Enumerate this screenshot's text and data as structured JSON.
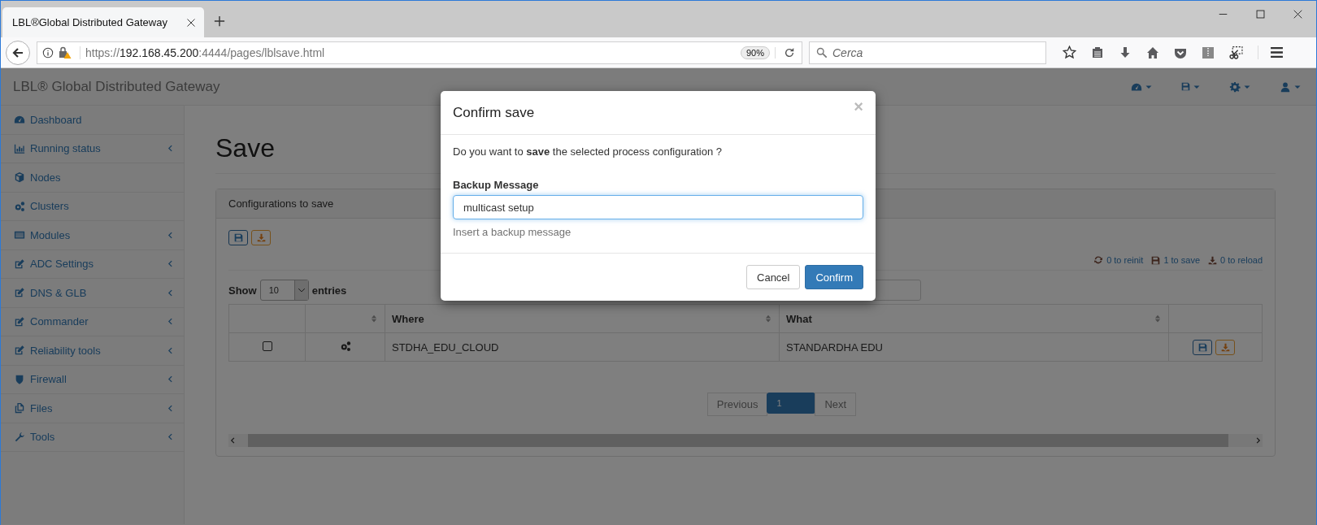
{
  "browser": {
    "tab_title": "LBL®Global Distributed Gateway",
    "url": {
      "scheme": "https://",
      "host": "192.168.45.200",
      "path": ":4444/pages/lblsave.html"
    },
    "zoom": "90%",
    "search_placeholder": "Cerca"
  },
  "app": {
    "brand": "LBL® Global Distributed Gateway"
  },
  "sidebar": {
    "items": [
      {
        "label": "Dashboard",
        "has_submenu": false
      },
      {
        "label": "Running status",
        "has_submenu": true
      },
      {
        "label": "Nodes",
        "has_submenu": false
      },
      {
        "label": "Clusters",
        "has_submenu": false
      },
      {
        "label": "Modules",
        "has_submenu": true
      },
      {
        "label": "ADC Settings",
        "has_submenu": true
      },
      {
        "label": "DNS & GLB",
        "has_submenu": true
      },
      {
        "label": "Commander",
        "has_submenu": true
      },
      {
        "label": "Reliability tools",
        "has_submenu": true
      },
      {
        "label": "Firewall",
        "has_submenu": true
      },
      {
        "label": "Files",
        "has_submenu": true
      },
      {
        "label": "Tools",
        "has_submenu": true
      }
    ]
  },
  "page": {
    "title": "Save",
    "panel_title": "Configurations to save",
    "counters": [
      {
        "text": "0 to reinit"
      },
      {
        "text": "1 to save"
      },
      {
        "text": "0 to reload"
      }
    ],
    "length_menu": {
      "before": "Show",
      "value": "10",
      "after": "entries"
    },
    "table": {
      "columns": [
        {
          "sortable": false
        },
        {
          "sortable": true
        },
        {
          "label": "Where",
          "sortable": true
        },
        {
          "label": "What",
          "sortable": true
        },
        {
          "sortable": false
        }
      ],
      "rows": [
        {
          "checked": false,
          "where": "STDHA_EDU_CLOUD",
          "what": "STANDARDHA EDU"
        }
      ]
    },
    "pagination": {
      "previous": {
        "label": "Previous",
        "disabled": true
      },
      "pages": [
        {
          "label": "1",
          "selected": true
        }
      ],
      "next": {
        "label": "Next",
        "disabled": true
      }
    }
  },
  "modal": {
    "title": "Confirm save",
    "close": "×",
    "message": "Do you want to **save** the selected process configuration ?",
    "field_label": "Backup Message",
    "field_value": "multicast setup",
    "help": "Insert a backup message",
    "buttons": [
      {
        "label": "Cancel",
        "kind": "default"
      },
      {
        "label": "Confirm",
        "kind": "primary"
      }
    ]
  }
}
